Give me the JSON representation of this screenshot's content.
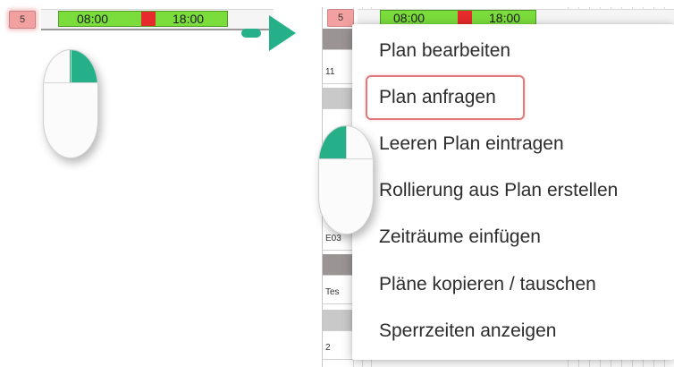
{
  "left_row": {
    "cell_number": "5",
    "shift_start": "08:00",
    "shift_end": "18:00"
  },
  "right_row": {
    "cell_number": "5",
    "shift_start": "08:00",
    "shift_end": "18:00"
  },
  "grid_labels": {
    "r1": "11",
    "r2": "E03",
    "r3": "Tes",
    "r4": "2"
  },
  "context_menu": {
    "items": [
      "Plan bearbeiten",
      "Plan anfragen",
      "Leeren Plan eintragen",
      "Rollierung aus Plan erstellen",
      "Zeiträume einfügen",
      "Pläne kopieren / tauschen",
      "Sperrzeiten anzeigen"
    ],
    "highlighted_index": 1
  },
  "colors": {
    "shift_green": "#7bdd3c",
    "break_red": "#e52b2b",
    "accent_teal": "#26b08a",
    "highlight_red": "#e07b7b",
    "day_cell_pink": "#f2a0a0"
  },
  "icons": {
    "mouse_left": "mouse-right-click-icon",
    "arrow": "arrow-right-icon",
    "mouse_right": "mouse-left-click-icon"
  }
}
